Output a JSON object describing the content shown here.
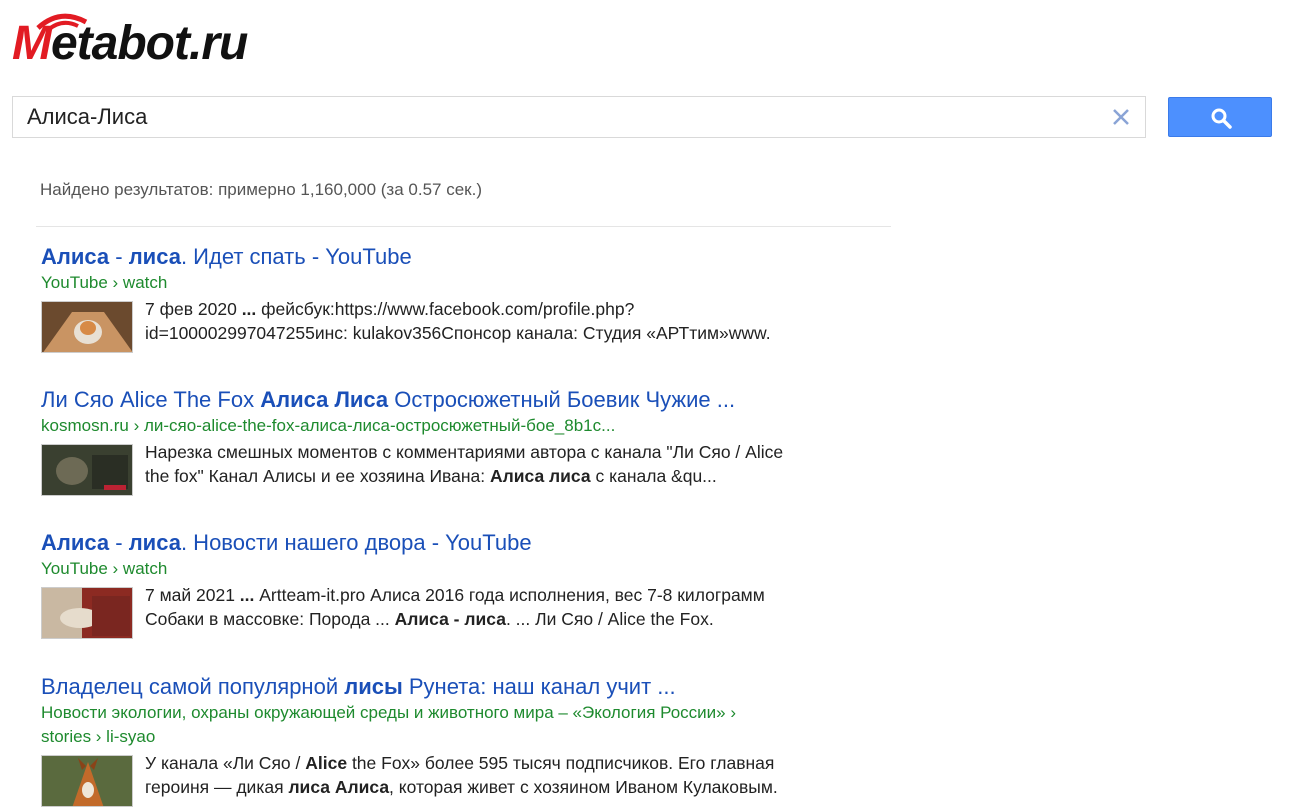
{
  "logo": {
    "prefix": "M",
    "rest": "etabot.ru"
  },
  "search": {
    "value": "Алиса-Лиса"
  },
  "stats": "Найдено результатов: примерно 1,160,000 (за 0.57 сек.)",
  "results": [
    {
      "title_bold1": "Алиса",
      "title_mid": " - ",
      "title_bold2": "лиса",
      "title_rest": ". Идет спать - YouTube",
      "url": "YouTube › watch",
      "snippet_line1_pre": "7 фев 2020 ",
      "snippet_line1_bold": "...",
      "snippet_line1_post": " фейсбук:https://www.facebook.com/profile.php?",
      "snippet_line2": "id=100002997047255инс: kulakov356Спонсор канала: Студия «АРТтим»www."
    },
    {
      "title_pre": "Ли Сяо Alice The Fox ",
      "title_bold": "Алиса Лиса",
      "title_post": " Остросюжетный Боевик Чужие ...",
      "url": "kosmosn.ru › ли-сяо-alice-the-fox-алиса-лиса-остросюжетный-бое_8b1c...",
      "snippet_line1": "Нарезка смешных моментов с комментариями автора с канала \"Ли Сяо / Alice",
      "snippet_line2_pre": "the fox\" Канал Алисы и ее хозяина Ивана: ",
      "snippet_line2_bold": "Алиса лиса",
      "snippet_line2_post": " с канала &qu..."
    },
    {
      "title_bold1": "Алиса",
      "title_mid": " - ",
      "title_bold2": "лиса",
      "title_rest": ". Новости нашего двора - YouTube",
      "url": "YouTube › watch",
      "snippet_line1_pre": "7 май 2021 ",
      "snippet_line1_bold": "...",
      "snippet_line1_post": " Artteam-it.pro Алиса 2016 года исполнения, вес 7-8 килограмм",
      "snippet_line2_pre": "Собаки в массовке: Порода ... ",
      "snippet_line2_bold": "Алиса - лиса",
      "snippet_line2_post": ". ... Ли Сяо / Alice the Fox."
    },
    {
      "title_pre": "Владелец самой популярной ",
      "title_bold": "лисы",
      "title_post": " Рунета: наш канал учит ...",
      "url_line1": "Новости экологии, охраны окружающей среды и животного мира – «Экология России» ›",
      "url_line2": "stories › li-syao",
      "snippet_line1_pre": "У канала «Ли Сяо / ",
      "snippet_line1_bold": "Alice",
      "snippet_line1_post": " the Fox» более 595 тысяч подписчиков. Его главная",
      "snippet_line2_pre": "героиня — дикая ",
      "snippet_line2_bold": "лиса Алиса",
      "snippet_line2_post": ", которая живет с хозяином Иваном Кулаковым."
    }
  ],
  "colors": {
    "accent": "#4d90fe",
    "link": "#1a4fb8",
    "url": "#1e8a2e",
    "logo_red": "#e21b23"
  }
}
